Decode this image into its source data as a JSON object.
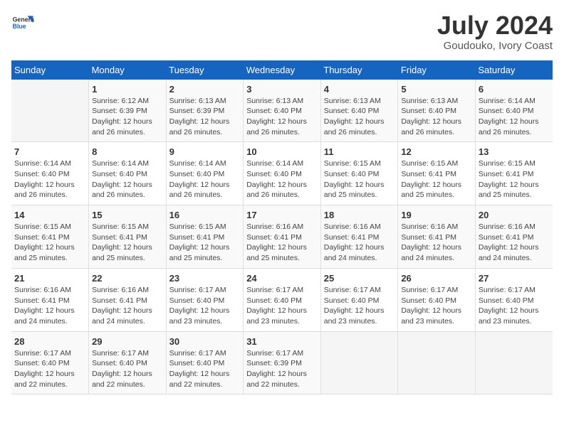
{
  "header": {
    "logo_general": "General",
    "logo_blue": "Blue",
    "month_year": "July 2024",
    "location": "Goudouko, Ivory Coast"
  },
  "days_of_week": [
    "Sunday",
    "Monday",
    "Tuesday",
    "Wednesday",
    "Thursday",
    "Friday",
    "Saturday"
  ],
  "weeks": [
    [
      {
        "day": "",
        "info": ""
      },
      {
        "day": "1",
        "info": "Sunrise: 6:12 AM\nSunset: 6:39 PM\nDaylight: 12 hours\nand 26 minutes."
      },
      {
        "day": "2",
        "info": "Sunrise: 6:13 AM\nSunset: 6:39 PM\nDaylight: 12 hours\nand 26 minutes."
      },
      {
        "day": "3",
        "info": "Sunrise: 6:13 AM\nSunset: 6:40 PM\nDaylight: 12 hours\nand 26 minutes."
      },
      {
        "day": "4",
        "info": "Sunrise: 6:13 AM\nSunset: 6:40 PM\nDaylight: 12 hours\nand 26 minutes."
      },
      {
        "day": "5",
        "info": "Sunrise: 6:13 AM\nSunset: 6:40 PM\nDaylight: 12 hours\nand 26 minutes."
      },
      {
        "day": "6",
        "info": "Sunrise: 6:14 AM\nSunset: 6:40 PM\nDaylight: 12 hours\nand 26 minutes."
      }
    ],
    [
      {
        "day": "7",
        "info": "Sunrise: 6:14 AM\nSunset: 6:40 PM\nDaylight: 12 hours\nand 26 minutes."
      },
      {
        "day": "8",
        "info": "Sunrise: 6:14 AM\nSunset: 6:40 PM\nDaylight: 12 hours\nand 26 minutes."
      },
      {
        "day": "9",
        "info": "Sunrise: 6:14 AM\nSunset: 6:40 PM\nDaylight: 12 hours\nand 26 minutes."
      },
      {
        "day": "10",
        "info": "Sunrise: 6:14 AM\nSunset: 6:40 PM\nDaylight: 12 hours\nand 26 minutes."
      },
      {
        "day": "11",
        "info": "Sunrise: 6:15 AM\nSunset: 6:40 PM\nDaylight: 12 hours\nand 25 minutes."
      },
      {
        "day": "12",
        "info": "Sunrise: 6:15 AM\nSunset: 6:41 PM\nDaylight: 12 hours\nand 25 minutes."
      },
      {
        "day": "13",
        "info": "Sunrise: 6:15 AM\nSunset: 6:41 PM\nDaylight: 12 hours\nand 25 minutes."
      }
    ],
    [
      {
        "day": "14",
        "info": "Sunrise: 6:15 AM\nSunset: 6:41 PM\nDaylight: 12 hours\nand 25 minutes."
      },
      {
        "day": "15",
        "info": "Sunrise: 6:15 AM\nSunset: 6:41 PM\nDaylight: 12 hours\nand 25 minutes."
      },
      {
        "day": "16",
        "info": "Sunrise: 6:15 AM\nSunset: 6:41 PM\nDaylight: 12 hours\nand 25 minutes."
      },
      {
        "day": "17",
        "info": "Sunrise: 6:16 AM\nSunset: 6:41 PM\nDaylight: 12 hours\nand 25 minutes."
      },
      {
        "day": "18",
        "info": "Sunrise: 6:16 AM\nSunset: 6:41 PM\nDaylight: 12 hours\nand 24 minutes."
      },
      {
        "day": "19",
        "info": "Sunrise: 6:16 AM\nSunset: 6:41 PM\nDaylight: 12 hours\nand 24 minutes."
      },
      {
        "day": "20",
        "info": "Sunrise: 6:16 AM\nSunset: 6:41 PM\nDaylight: 12 hours\nand 24 minutes."
      }
    ],
    [
      {
        "day": "21",
        "info": "Sunrise: 6:16 AM\nSunset: 6:41 PM\nDaylight: 12 hours\nand 24 minutes."
      },
      {
        "day": "22",
        "info": "Sunrise: 6:16 AM\nSunset: 6:41 PM\nDaylight: 12 hours\nand 24 minutes."
      },
      {
        "day": "23",
        "info": "Sunrise: 6:17 AM\nSunset: 6:40 PM\nDaylight: 12 hours\nand 23 minutes."
      },
      {
        "day": "24",
        "info": "Sunrise: 6:17 AM\nSunset: 6:40 PM\nDaylight: 12 hours\nand 23 minutes."
      },
      {
        "day": "25",
        "info": "Sunrise: 6:17 AM\nSunset: 6:40 PM\nDaylight: 12 hours\nand 23 minutes."
      },
      {
        "day": "26",
        "info": "Sunrise: 6:17 AM\nSunset: 6:40 PM\nDaylight: 12 hours\nand 23 minutes."
      },
      {
        "day": "27",
        "info": "Sunrise: 6:17 AM\nSunset: 6:40 PM\nDaylight: 12 hours\nand 23 minutes."
      }
    ],
    [
      {
        "day": "28",
        "info": "Sunrise: 6:17 AM\nSunset: 6:40 PM\nDaylight: 12 hours\nand 22 minutes."
      },
      {
        "day": "29",
        "info": "Sunrise: 6:17 AM\nSunset: 6:40 PM\nDaylight: 12 hours\nand 22 minutes."
      },
      {
        "day": "30",
        "info": "Sunrise: 6:17 AM\nSunset: 6:40 PM\nDaylight: 12 hours\nand 22 minutes."
      },
      {
        "day": "31",
        "info": "Sunrise: 6:17 AM\nSunset: 6:39 PM\nDaylight: 12 hours\nand 22 minutes."
      },
      {
        "day": "",
        "info": ""
      },
      {
        "day": "",
        "info": ""
      },
      {
        "day": "",
        "info": ""
      }
    ]
  ]
}
